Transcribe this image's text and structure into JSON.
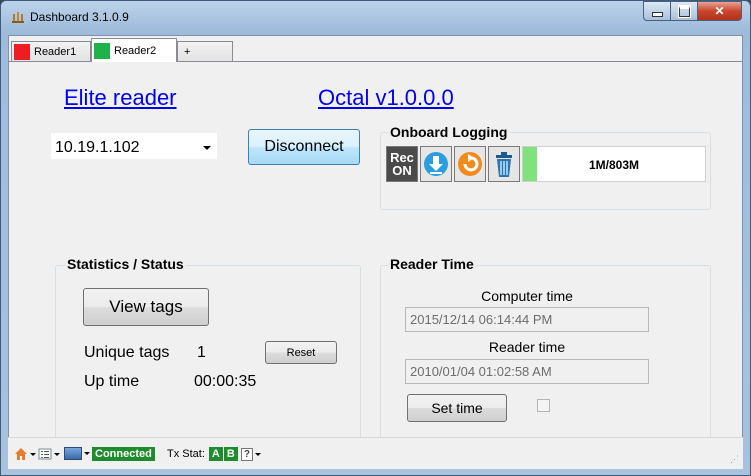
{
  "window": {
    "title": "Dashboard 3.1.0.9"
  },
  "tabs": [
    {
      "label": "Reader1",
      "color": "#ee1c24"
    },
    {
      "label": "Reader2",
      "color": "#1db34a"
    },
    {
      "label": "+"
    }
  ],
  "header": {
    "reader_link": "Elite reader",
    "firmware_link": "Octal v1.0.0.0"
  },
  "connection": {
    "ip": "10.19.1.102",
    "disconnect_label": "Disconnect"
  },
  "logging": {
    "title": "Onboard Logging",
    "rec_line1": "Rec",
    "rec_line2": "ON",
    "icons": [
      "record-icon",
      "download-icon",
      "refresh-icon",
      "trash-icon"
    ],
    "usage": "1M/803M",
    "usage_fraction": 0.00125
  },
  "stats": {
    "title": "Statistics / Status",
    "view_tags_label": "View tags",
    "unique_tags_label": "Unique tags",
    "unique_tags_value": "1",
    "reset_label": "Reset",
    "uptime_label": "Up time",
    "uptime_value": "00:00:35"
  },
  "reader_time": {
    "title": "Reader Time",
    "computer_time_label": "Computer time",
    "computer_time_value": "2015/12/14 06:14:44 PM",
    "reader_time_label": "Reader time",
    "reader_time_value": "2010/01/04 01:02:58 AM",
    "set_time_label": "Set time"
  },
  "statusbar": {
    "connected": "Connected",
    "tx_stat_label": "Tx Stat:",
    "tx_a": "A",
    "tx_b": "B",
    "help": "?"
  }
}
